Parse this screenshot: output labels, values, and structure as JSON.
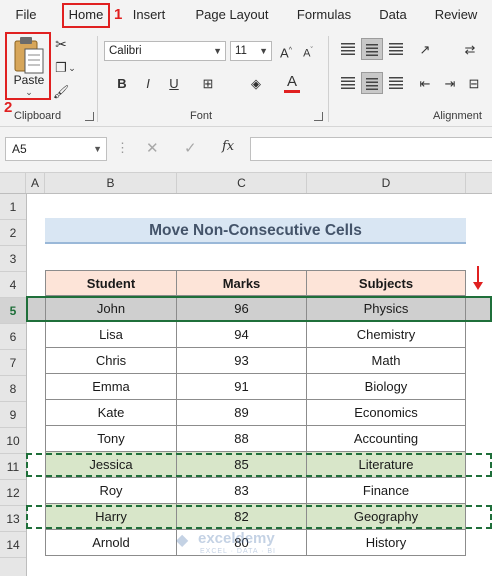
{
  "ribbon": {
    "tabs": [
      {
        "label": "File"
      },
      {
        "label": "Home"
      },
      {
        "label": "Insert"
      },
      {
        "label": "Page Layout"
      },
      {
        "label": "Formulas"
      },
      {
        "label": "Data"
      },
      {
        "label": "Review"
      }
    ],
    "step1_marker": "1",
    "step2_marker": "2",
    "clipboard": {
      "paste_label": "Paste",
      "group_label": "Clipboard"
    },
    "font": {
      "name": "Calibri",
      "size": "11",
      "group_label": "Font",
      "font_color": "#e02020"
    },
    "alignment": {
      "group_label": "Alignment"
    }
  },
  "formula_bar": {
    "name_box": "A5",
    "fx_label": "fx",
    "value": ""
  },
  "grid": {
    "columns": [
      "A",
      "B",
      "C",
      "D"
    ],
    "rows": [
      "1",
      "2",
      "3",
      "4",
      "5",
      "6",
      "7",
      "8",
      "9",
      "10",
      "11",
      "12",
      "13",
      "14"
    ],
    "title": "Move Non-Consecutive Cells",
    "headers": [
      "Student",
      "Marks",
      "Subjects"
    ],
    "data": [
      [
        "John",
        "96",
        "Physics"
      ],
      [
        "Lisa",
        "94",
        "Chemistry"
      ],
      [
        "Chris",
        "93",
        "Math"
      ],
      [
        "Emma",
        "91",
        "Biology"
      ],
      [
        "Kate",
        "89",
        "Economics"
      ],
      [
        "Tony",
        "88",
        "Accounting"
      ],
      [
        "Jessica",
        "85",
        "Literature"
      ],
      [
        "Roy",
        "83",
        "Finance"
      ],
      [
        "Harry",
        "82",
        "Geography"
      ],
      [
        "Arnold",
        "80",
        "History"
      ]
    ],
    "watermark": "exceldemy",
    "watermark_sub": "EXCEL · DATA · BI"
  },
  "colors": {
    "accent_green": "#1f6f3a",
    "header_fill": "#fde4d8",
    "title_fill": "#d9e6f3",
    "highlight_green": "#d8e6c9",
    "selected_gray": "#cfcfcf",
    "annotation_red": "#e02020"
  }
}
